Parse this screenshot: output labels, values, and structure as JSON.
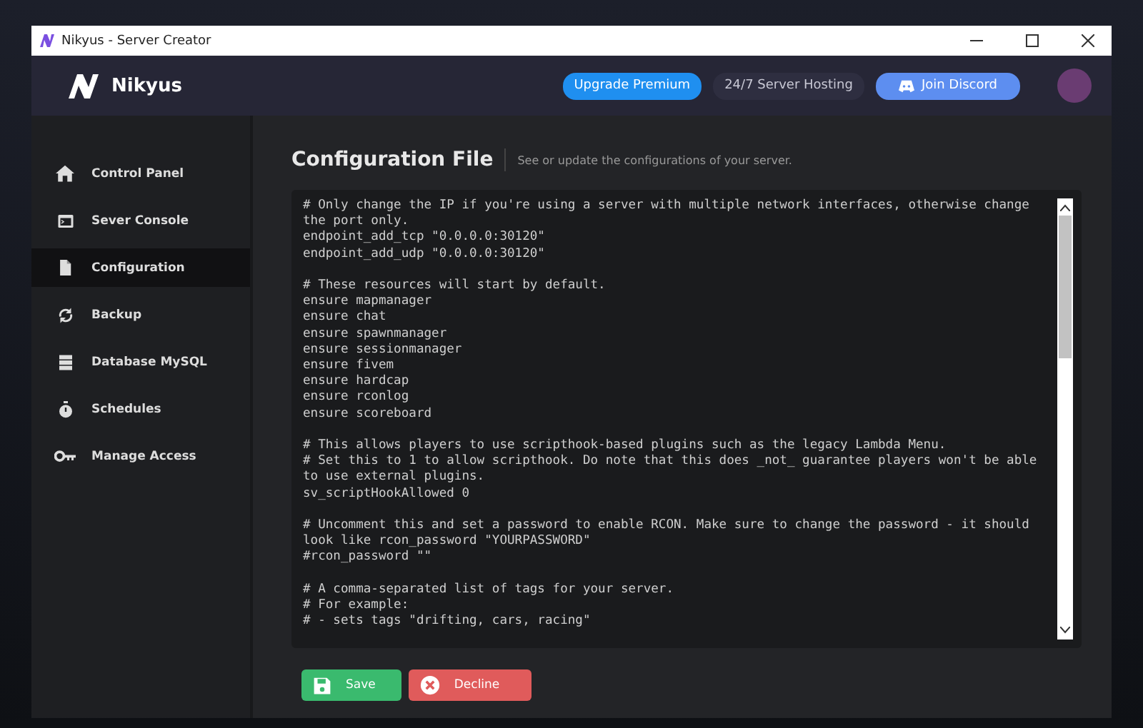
{
  "window": {
    "title": "Nikyus - Server Creator"
  },
  "header": {
    "brand": "Nikyus",
    "buttons": [
      {
        "label": "Upgrade Premium",
        "kind": "primary"
      },
      {
        "label": "24/7 Server Hosting",
        "kind": "plain"
      },
      {
        "label": "Join Discord",
        "kind": "discord"
      }
    ]
  },
  "sidebar": {
    "items": [
      {
        "label": "Control Panel",
        "selected": false
      },
      {
        "label": "Sever Console",
        "selected": false
      },
      {
        "label": "Configuration",
        "selected": true
      },
      {
        "label": "Backup",
        "selected": false
      },
      {
        "label": "Database MySQL",
        "selected": false
      },
      {
        "label": "Schedules",
        "selected": false
      },
      {
        "label": "Manage Access",
        "selected": false
      }
    ]
  },
  "page": {
    "title": "Configuration File",
    "subtitle": "See or update the configurations of your server."
  },
  "editor": {
    "value": "# Only change the IP if you're using a server with multiple network interfaces, otherwise change the port only.\nendpoint_add_tcp \"0.0.0.0:30120\"\nendpoint_add_udp \"0.0.0.0:30120\"\n\n# These resources will start by default.\nensure mapmanager\nensure chat\nensure spawnmanager\nensure sessionmanager\nensure fivem\nensure hardcap\nensure rconlog\nensure scoreboard\n\n# This allows players to use scripthook-based plugins such as the legacy Lambda Menu.\n# Set this to 1 to allow scripthook. Do note that this does _not_ guarantee players won't be able to use external plugins.\nsv_scriptHookAllowed 0\n\n# Uncomment this and set a password to enable RCON. Make sure to change the password - it should look like rcon_password \"YOURPASSWORD\"\n#rcon_password \"\"\n\n# A comma-separated list of tags for your server.\n# For example:\n# - sets tags \"drifting, cars, racing\""
  },
  "actions": [
    {
      "label": "Save",
      "kind": "save"
    },
    {
      "label": "Decline",
      "kind": "decline"
    }
  ]
}
